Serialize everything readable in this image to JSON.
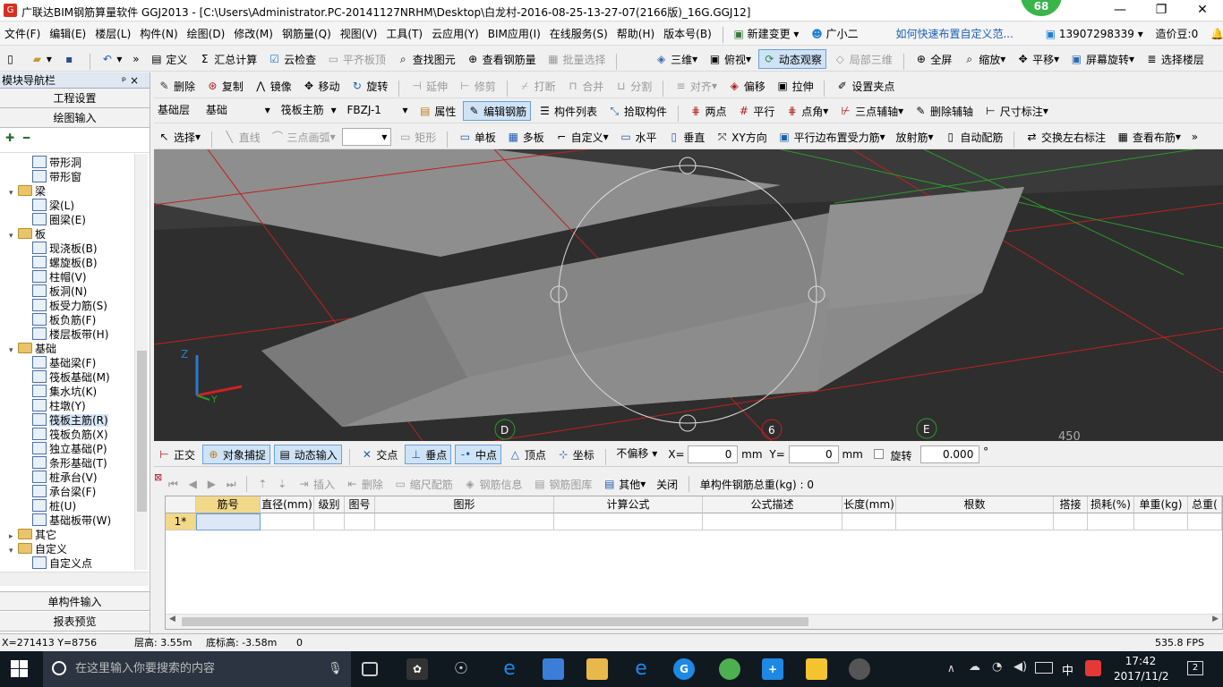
{
  "titlebar": {
    "title": "广联达BIM钢筋算量软件 GGJ2013 - [C:\\Users\\Administrator.PC-20141127NRHM\\Desktop\\白龙村-2016-08-25-13-27-07(2166版)_16G.GGJ12]",
    "badge": "68",
    "min": "—",
    "max": "❐",
    "close": "✕"
  },
  "menu": {
    "items": [
      "文件(F)",
      "编辑(E)",
      "楼层(L)",
      "构件(N)",
      "绘图(D)",
      "修改(M)",
      "钢筋量(Q)",
      "视图(V)",
      "工具(T)",
      "云应用(Y)",
      "BIM应用(I)",
      "在线服务(S)",
      "帮助(H)",
      "版本号(B)"
    ],
    "new_change": "新建变更",
    "assistant": "广小二",
    "tip": "如何快速布置自定义范...",
    "phone": "13907298339",
    "beans": "造价豆:0"
  },
  "toolbar1": {
    "items": [
      "定义",
      "汇总计算",
      "云检查",
      "平齐板顶",
      "查找图元",
      "查看钢筋量",
      "批量选择"
    ],
    "view_items": [
      "三维",
      "俯视",
      "动态观察",
      "局部三维",
      "全屏",
      "缩放",
      "平移",
      "屏幕旋转",
      "选择楼层"
    ]
  },
  "nav": {
    "title": "模块导航栏",
    "pin": "ᵖ ×",
    "project_settings": "工程设置",
    "drawing_input": "绘图输入",
    "single_input": "单构件输入",
    "report_preview": "报表预览",
    "tree": [
      {
        "label": "带形洞",
        "level": 2
      },
      {
        "label": "带形窗",
        "level": 2
      },
      {
        "label": "梁",
        "level": 1,
        "folder": true
      },
      {
        "label": "梁(L)",
        "level": 2
      },
      {
        "label": "圈梁(E)",
        "level": 2
      },
      {
        "label": "板",
        "level": 1,
        "folder": true
      },
      {
        "label": "现浇板(B)",
        "level": 2
      },
      {
        "label": "螺旋板(B)",
        "level": 2
      },
      {
        "label": "柱帽(V)",
        "level": 2
      },
      {
        "label": "板洞(N)",
        "level": 2
      },
      {
        "label": "板受力筋(S)",
        "level": 2
      },
      {
        "label": "板负筋(F)",
        "level": 2
      },
      {
        "label": "楼层板带(H)",
        "level": 2
      },
      {
        "label": "基础",
        "level": 1,
        "folder": true
      },
      {
        "label": "基础梁(F)",
        "level": 2
      },
      {
        "label": "筏板基础(M)",
        "level": 2
      },
      {
        "label": "集水坑(K)",
        "level": 2
      },
      {
        "label": "柱墩(Y)",
        "level": 2
      },
      {
        "label": "筏板主筋(R)",
        "level": 2,
        "selected": true
      },
      {
        "label": "筏板负筋(X)",
        "level": 2
      },
      {
        "label": "独立基础(P)",
        "level": 2
      },
      {
        "label": "条形基础(T)",
        "level": 2
      },
      {
        "label": "桩承台(V)",
        "level": 2
      },
      {
        "label": "承台梁(F)",
        "level": 2
      },
      {
        "label": "桩(U)",
        "level": 2
      },
      {
        "label": "基础板带(W)",
        "level": 2
      },
      {
        "label": "其它",
        "level": 1,
        "folder": true,
        "collapsed": true
      },
      {
        "label": "自定义",
        "level": 1,
        "folder": true
      },
      {
        "label": "自定义点",
        "level": 2
      }
    ]
  },
  "toolbar2": {
    "items": [
      "删除",
      "复制",
      "镜像",
      "移动",
      "旋转",
      "延伸",
      "修剪",
      "打断",
      "合并",
      "分割",
      "对齐",
      "偏移",
      "拉伸",
      "设置夹点"
    ]
  },
  "toolbar3": {
    "floor": "基础层",
    "category": "基础",
    "type": "筏板主筋",
    "name": "FBZJ-1",
    "items": [
      "属性",
      "编辑钢筋",
      "构件列表",
      "拾取构件",
      "两点",
      "平行",
      "点角",
      "三点辅轴",
      "删除辅轴",
      "尺寸标注"
    ]
  },
  "toolbar4": {
    "items": [
      "选择",
      "直线",
      "三点画弧",
      "矩形",
      "单板",
      "多板",
      "自定义",
      "水平",
      "垂直",
      "XY方向",
      "平行边布置受力筋",
      "放射筋",
      "自动配筋",
      "交换左右标注",
      "查看布筋"
    ]
  },
  "viewport": {
    "axis_labels": [
      "D",
      "6",
      "E"
    ],
    "dim": "450",
    "z": "Z",
    "y": "Y"
  },
  "snapbar": {
    "items": [
      "正交",
      "对象捕捉",
      "动态输入",
      "交点",
      "垂点",
      "中点",
      "顶点",
      "坐标"
    ],
    "offset": "不偏移",
    "x_label": "X=",
    "x_val": "0",
    "mm": "mm",
    "y_label": "Y=",
    "y_val": "0",
    "rotate": "旋转",
    "rotate_val": "0.000",
    "deg": "°"
  },
  "gridtb": {
    "items": [
      "插入",
      "删除",
      "缩尺配筋",
      "钢筋信息",
      "钢筋图库",
      "其他",
      "关闭"
    ],
    "total": "单构件钢筋总重(kg) : 0"
  },
  "grid": {
    "headers": [
      "筋号",
      "直径(mm)",
      "级别",
      "图号",
      "图形",
      "计算公式",
      "公式描述",
      "长度(mm)",
      "根数",
      "搭接",
      "损耗(%)",
      "单重(kg)",
      "总重("
    ],
    "row_label": "1*"
  },
  "status": {
    "coords": "X=271413 Y=8756",
    "floor_height": "层高: 3.55m",
    "bottom_height": "底标高: -3.58m",
    "count": "0",
    "fps": "535.8 FPS"
  },
  "taskbar": {
    "search": "在这里输入你要搜索的内容",
    "ime": "中",
    "time": "17:42",
    "date": "2017/11/2",
    "notif": "2"
  }
}
